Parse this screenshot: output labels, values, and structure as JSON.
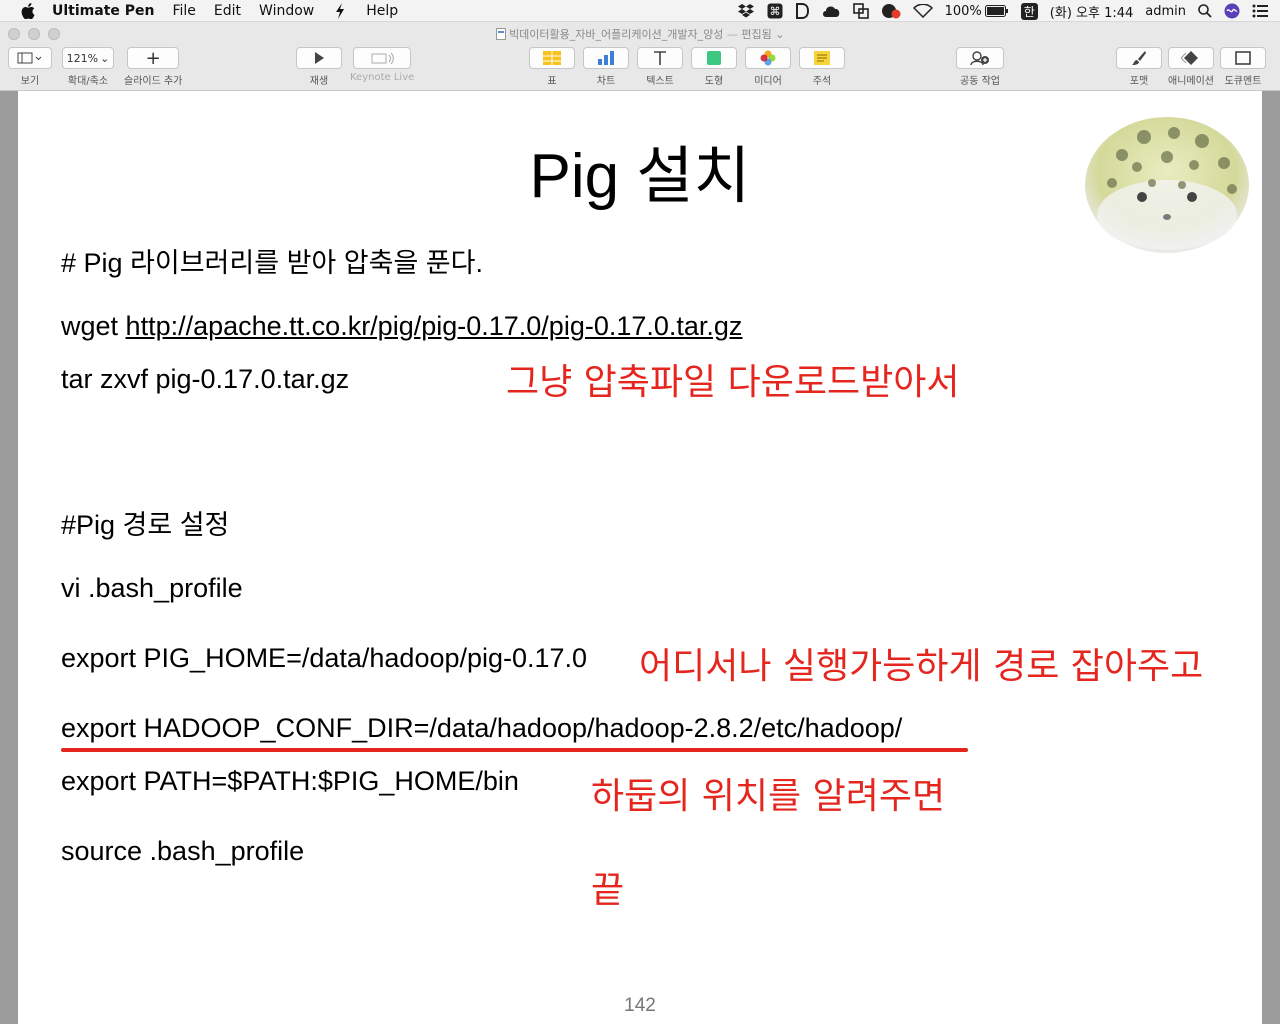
{
  "menubar": {
    "app_name": "Ultimate Pen",
    "items": [
      "File",
      "Edit",
      "Window",
      "Help"
    ],
    "status": {
      "battery": "100%",
      "input": "한",
      "clock": "(화) 오후 1:44",
      "user": "admin"
    }
  },
  "window": {
    "doc_title": "빅데이터활용_자바_어플리케이션_개발자_양성",
    "doc_state": "편집됨"
  },
  "toolbar": {
    "view_label": "보기",
    "zoom_value": "121%",
    "zoom_label": "확대/축소",
    "add_slide_label": "슬라이드 추가",
    "play_label": "재생",
    "keynote_live_label": "Keynote Live",
    "table_label": "표",
    "chart_label": "차트",
    "text_label": "텍스트",
    "shape_label": "도형",
    "media_label": "미디어",
    "comment_label": "주석",
    "collab_label": "공동 작업",
    "format_label": "포맷",
    "animate_label": "애니메이션",
    "document_label": "도큐멘트"
  },
  "slide": {
    "title": "Pig 설치",
    "line1": "# Pig 라이브러리를 받아 압축을 푼다.",
    "line2_cmd": "wget ",
    "line2_url": "http://apache.tt.co.kr/pig/pig-0.17.0/pig-0.17.0.tar.gz",
    "line3": "tar zxvf pig-0.17.0.tar.gz",
    "line4": "#Pig 경로 설정",
    "line5": "vi .bash_profile",
    "line6": "export PIG_HOME=/data/hadoop/pig-0.17.0",
    "line7": "export HADOOP_CONF_DIR=/data/hadoop/hadoop-2.8.2/etc/hadoop/",
    "line8": "export PATH=$PATH:$PIG_HOME/bin",
    "line9": "source .bash_profile",
    "annotations": {
      "a1": "그냥 압축파일 다운로드받아서",
      "a2": "어디서나 실행가능하게 경로 잡아주고",
      "a3": "하둡의 위치를 알려주면",
      "a4": "끝"
    },
    "page_number": "142"
  },
  "colors": {
    "annotation_red": "#e5261e",
    "slide_bg": "#ffffff",
    "canvas_bg": "#9b9b9b"
  }
}
